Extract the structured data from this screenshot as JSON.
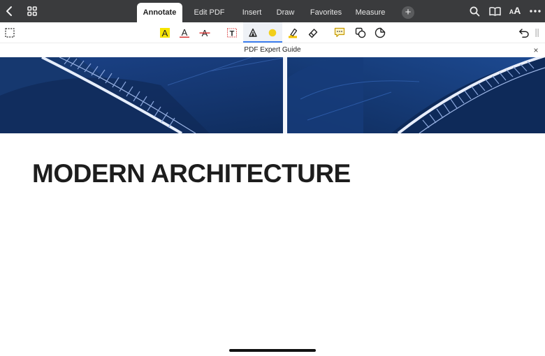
{
  "top_bar": {
    "back_icon": "chevron-left-icon",
    "grid_icon": "grid-icon",
    "tabs": [
      {
        "label": "Annotate",
        "active": true
      },
      {
        "label": "Edit PDF",
        "active": false
      },
      {
        "label": "Insert",
        "active": false
      },
      {
        "label": "Draw",
        "active": false
      },
      {
        "label": "Favorites",
        "active": false
      },
      {
        "label": "Measure",
        "active": false
      }
    ],
    "add_label": "+",
    "right_icons": [
      "search-icon",
      "book-icon",
      "text-size-icon",
      "more-icon"
    ],
    "text_size_glyph_small": "A",
    "text_size_glyph_large": "A"
  },
  "annotation_toolbar": {
    "tools": [
      {
        "name": "selection",
        "glyph": "A"
      },
      {
        "name": "highlight",
        "glyph": "A"
      },
      {
        "name": "underline",
        "glyph": "A"
      },
      {
        "name": "strikethrough",
        "glyph": "A"
      },
      {
        "name": "text-box",
        "glyph": "T"
      }
    ],
    "colors": {
      "highlight": "#f7e500",
      "underline": "#d93b3b",
      "strikethrough": "#d93b3b",
      "pen_color": "#f2cf1a",
      "selected_underline": "#3d7ff0"
    }
  },
  "document": {
    "title": "PDF Expert Guide",
    "close_glyph": "×",
    "heading": "MODERN ARCHITECTURE"
  },
  "colors": {
    "topbar_bg": "#3a3b3d",
    "hero_blue": "#13356e"
  }
}
